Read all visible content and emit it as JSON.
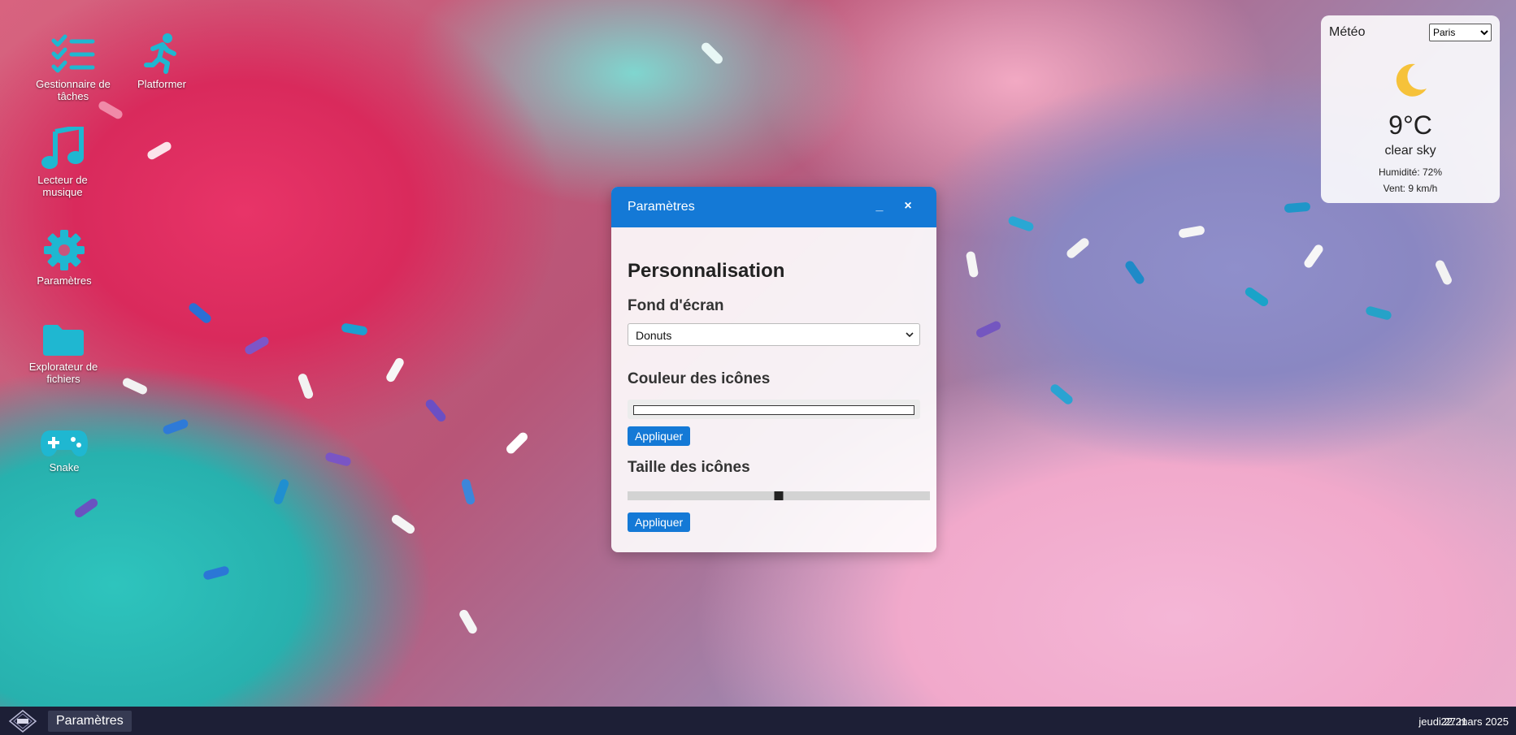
{
  "desktop": {
    "wallpaper": "Donuts",
    "icon_color": "#1fb7d1",
    "icons": [
      {
        "label": "Gestionnaire de tâches",
        "icon": "checklist-icon"
      },
      {
        "label": "Platformer",
        "icon": "running-person-icon"
      },
      {
        "label": "Lecteur de musique",
        "icon": "music-note-icon"
      },
      {
        "label": "Paramètres",
        "icon": "gear-icon"
      },
      {
        "label": "Explorateur de fichiers",
        "icon": "folder-icon"
      },
      {
        "label": "Snake",
        "icon": "gamepad-icon"
      }
    ]
  },
  "weather": {
    "title": "Météo",
    "city_selected": "Paris",
    "icon": "crescent-moon-icon",
    "temperature": "9°C",
    "description": "clear sky",
    "humidity": "Humidité: 72%",
    "wind": "Vent: 9 km/h"
  },
  "settings_window": {
    "title": "Paramètres",
    "minimize_label": "_",
    "close_label": "×",
    "heading": "Personnalisation",
    "wallpaper_section": {
      "label": "Fond d'écran",
      "selected": "Donuts"
    },
    "icon_color_section": {
      "label": "Couleur des icônes",
      "value": "#ffffff",
      "apply_label": "Appliquer"
    },
    "icon_size_section": {
      "label": "Taille des icônes",
      "slider_value": 0.5,
      "apply_label": "Appliquer"
    }
  },
  "taskbar": {
    "start_icon": "logo-icon",
    "open_app": "Paramètres",
    "time": "22:21",
    "date": "jeudi 27 mars 2025"
  }
}
